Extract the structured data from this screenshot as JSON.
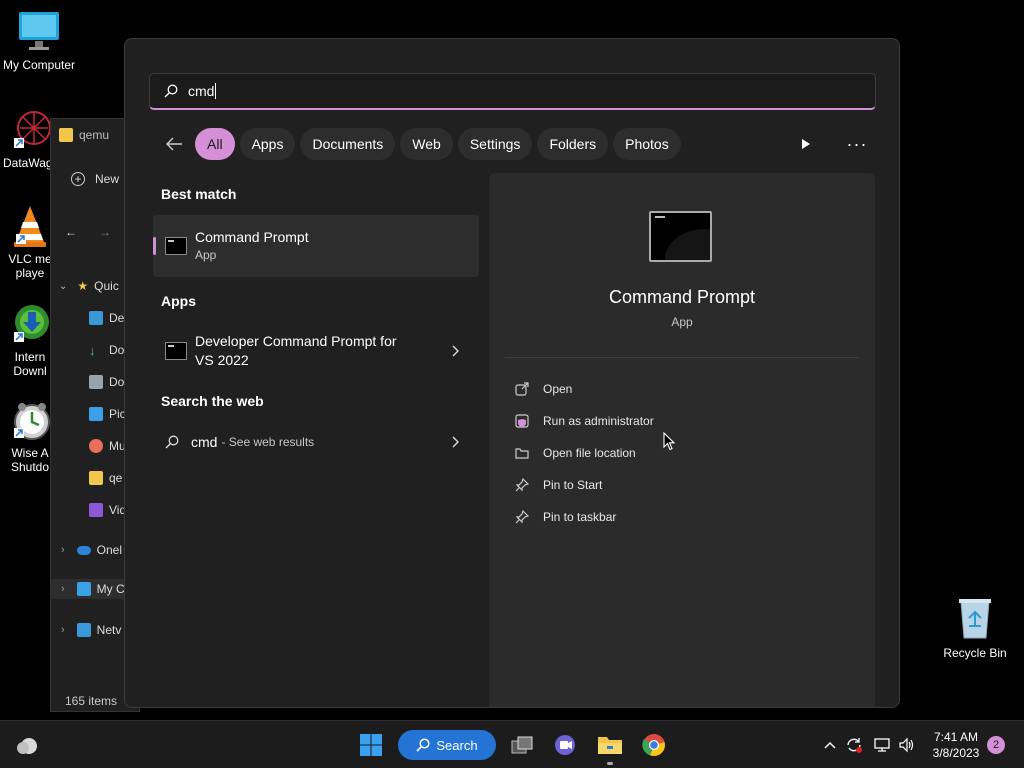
{
  "desktop": {
    "icons": [
      {
        "label": "My Computer",
        "icon": "monitor-icon"
      },
      {
        "label": "DataWag",
        "icon": "datawag-icon"
      },
      {
        "label": "VLC me playe",
        "icon": "vlc-icon"
      },
      {
        "label": "Intern Downl",
        "icon": "idm-icon"
      },
      {
        "label": "Wise A Shutdo",
        "icon": "wise-shutdown-icon"
      }
    ],
    "recycle_bin_label": "Recycle Bin"
  },
  "explorer": {
    "title": "qemu",
    "new_label": "New",
    "quick_access": "Quic",
    "items": [
      "De",
      "Do",
      "Do",
      "Pic",
      "Mu",
      "qe",
      "Vid"
    ],
    "onedrive": "Onel",
    "mycomputer": "My C",
    "network": "Netv",
    "status": "165 items"
  },
  "search": {
    "query": "cmd",
    "filters": [
      "All",
      "Apps",
      "Documents",
      "Web",
      "Settings",
      "Folders",
      "Photos"
    ],
    "active_filter": "All"
  },
  "results": {
    "best_match_header": "Best match",
    "best_match": {
      "title": "Command Prompt",
      "subtitle": "App"
    },
    "apps_header": "Apps",
    "apps": [
      {
        "title_line1": "Developer Command Prompt for",
        "title_line2": "VS 2022"
      }
    ],
    "web_header": "Search the web",
    "web": {
      "query": "cmd",
      "suffix": "- See web results"
    }
  },
  "preview": {
    "title": "Command Prompt",
    "subtitle": "App",
    "actions": [
      {
        "label": "Open",
        "icon": "open-external-icon"
      },
      {
        "label": "Run as administrator",
        "icon": "shield-icon"
      },
      {
        "label": "Open file location",
        "icon": "folder-icon"
      },
      {
        "label": "Pin to Start",
        "icon": "pin-icon"
      },
      {
        "label": "Pin to taskbar",
        "icon": "pin-icon"
      }
    ]
  },
  "taskbar": {
    "search_label": "Search",
    "time": "7:41 AM",
    "date": "3/8/2023",
    "notification_count": "2"
  },
  "colors": {
    "accent": "#d58fd6",
    "taskbar_search": "#2474d6"
  }
}
